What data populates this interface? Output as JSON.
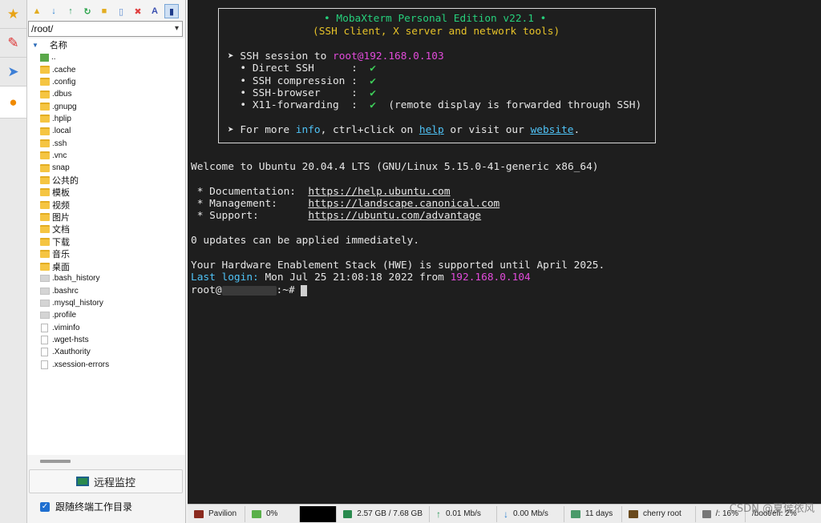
{
  "sidebar_tabs": [
    "star-icon",
    "tools-icon",
    "send-icon",
    "globe-icon"
  ],
  "toolbar": {
    "buttons": [
      "folder-up-icon",
      "download-icon",
      "upload-icon",
      "refresh-icon",
      "new-folder-icon",
      "new-file-icon",
      "delete-icon",
      "text-icon",
      "bookmark-icon"
    ],
    "text_label": "A"
  },
  "path": "/root/",
  "file_list": {
    "header": "名称",
    "items": [
      {
        "name": "..",
        "type": "up"
      },
      {
        "name": ".cache",
        "type": "folder"
      },
      {
        "name": ".config",
        "type": "folder"
      },
      {
        "name": ".dbus",
        "type": "folder"
      },
      {
        "name": ".gnupg",
        "type": "folder"
      },
      {
        "name": ".hplip",
        "type": "folder"
      },
      {
        "name": ".local",
        "type": "folder"
      },
      {
        "name": ".ssh",
        "type": "folder"
      },
      {
        "name": ".vnc",
        "type": "folder"
      },
      {
        "name": "snap",
        "type": "folder"
      },
      {
        "name": "公共的",
        "type": "folder"
      },
      {
        "name": "模板",
        "type": "folder"
      },
      {
        "name": "视频",
        "type": "folder"
      },
      {
        "name": "图片",
        "type": "folder"
      },
      {
        "name": "文档",
        "type": "folder"
      },
      {
        "name": "下载",
        "type": "folder"
      },
      {
        "name": "音乐",
        "type": "folder"
      },
      {
        "name": "桌面",
        "type": "folder"
      },
      {
        "name": ".bash_history",
        "type": "hidden"
      },
      {
        "name": ".bashrc",
        "type": "hidden"
      },
      {
        "name": ".mysql_history",
        "type": "hidden"
      },
      {
        "name": ".profile",
        "type": "hidden"
      },
      {
        "name": ".viminfo",
        "type": "file"
      },
      {
        "name": ".wget-hsts",
        "type": "file"
      },
      {
        "name": ".Xauthority",
        "type": "file"
      },
      {
        "name": ".xsession-errors",
        "type": "file"
      }
    ]
  },
  "remote_monitor_button": "远程监控",
  "follow_terminal": {
    "label": "跟随终端工作目录",
    "checked": true
  },
  "terminal": {
    "banner_title": "• MobaXterm Personal Edition v22.1 •",
    "banner_subtitle": "(SSH client, X server and network tools)",
    "session_prefix": "➤ SSH session to ",
    "session_host": "root@192.168.0.103",
    "feat1_label": "  • Direct SSH      :  ",
    "feat2_label": "  • SSH compression :  ",
    "feat3_label": "  • SSH-browser     :  ",
    "feat4_label": "  • X11-forwarding  :  ",
    "check": "✔",
    "feat4_note": "  (remote display is forwarded through SSH)",
    "more_prefix": "➤ For more ",
    "more_info": "info",
    "more_mid": ", ctrl+click on ",
    "more_help": "help",
    "more_mid2": " or visit our ",
    "more_website": "website",
    "more_end": ".",
    "welcome": "Welcome to Ubuntu 20.04.4 LTS (GNU/Linux 5.15.0-41-generic x86_64)",
    "doc_label": " * Documentation:  ",
    "doc_url": "https://help.ubuntu.com",
    "mgmt_label": " * Management:     ",
    "mgmt_url": "https://landscape.canonical.com",
    "support_label": " * Support:        ",
    "support_url": "https://ubuntu.com/advantage",
    "updates": "0 updates can be applied immediately.",
    "hwe": "Your Hardware Enablement Stack (HWE) is supported until April 2025.",
    "last_login_label": "Last login:",
    "last_login_time": " Mon Jul 25 21:08:18 2022 from ",
    "last_login_ip": "192.168.0.104",
    "prompt_user": "root@",
    "prompt_tail": ":~# "
  },
  "statusbar": {
    "host": "Pavilion",
    "cpu": "0%",
    "memory": "2.57 GB / 7.68 GB",
    "upload": "0.01 Mb/s",
    "download": "0.00 Mb/s",
    "uptime": "11 days",
    "users": "cherry  root",
    "disk_root": "/: 16%",
    "disk_boot": "/boot/efi: 2%"
  },
  "watermark": "CSDN @夏侯依风",
  "colors": {
    "terminal_bg": "#1e1e1e",
    "accent_green": "#26d07c",
    "accent_magenta": "#e24bdb",
    "accent_cyan": "#4fc3f7"
  }
}
